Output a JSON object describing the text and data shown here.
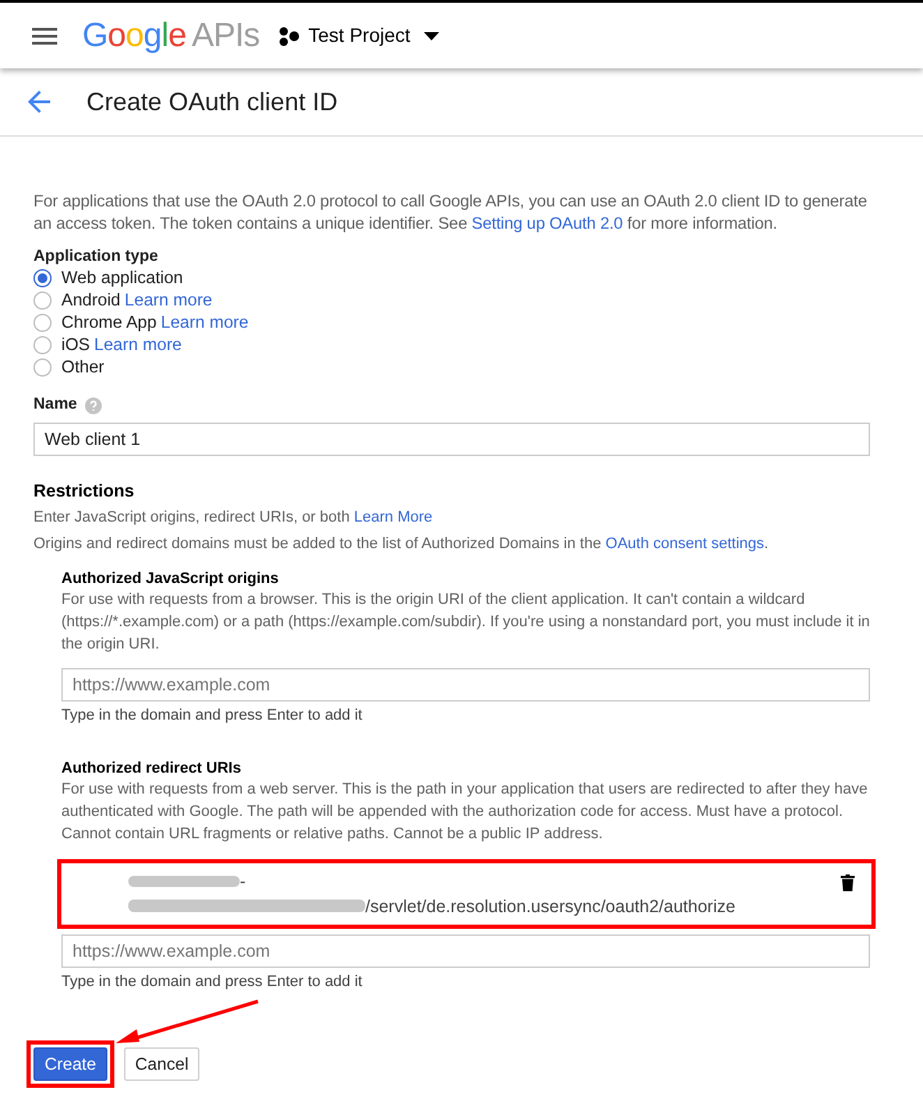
{
  "header": {
    "logo_brand": "Google",
    "logo_product": "APIs",
    "project": "Test Project"
  },
  "title_bar": {
    "title": "Create OAuth client ID"
  },
  "intro": {
    "text": "For applications that use the OAuth 2.0 protocol to call Google APIs, you can use an OAuth 2.0 client ID to generate an access token. The token contains a unique identifier. See ",
    "link": "Setting up OAuth 2.0",
    "after": " for more information."
  },
  "application_type": {
    "label": "Application type",
    "options": [
      {
        "label": "Web application",
        "selected": true
      },
      {
        "label": "Android",
        "link": "Learn more",
        "selected": false
      },
      {
        "label": "Chrome App",
        "link": "Learn more",
        "selected": false
      },
      {
        "label": "iOS",
        "link": "Learn more",
        "selected": false
      },
      {
        "label": "Other",
        "selected": false
      }
    ]
  },
  "name_field": {
    "label": "Name",
    "value": "Web client 1"
  },
  "restrictions": {
    "title": "Restrictions",
    "line_1": "Enter JavaScript origins, redirect URIs, or both ",
    "line_1_link": "Learn More",
    "line_2": "Origins and redirect domains must be added to the list of Authorized Domains in the ",
    "line_2_link": "OAuth consent settings",
    "line_2_end": "."
  },
  "sections": [
    {
      "title": "Authorized JavaScript origins",
      "description": "For use with requests from a browser. This is the origin URI of the client application. It can't contain a wildcard (https://*.example.com) or a path (https://example.com/subdir). If you're using a nonstandard port, you must include it in the origin URI.",
      "placeholder": "https://www.example.com",
      "hint": "Type in the domain and press Enter to add it"
    },
    {
      "title": "Authorized redirect URIs",
      "description": "For use with requests from a web server. This is the path in your application that users are redirected to after they have authenticated with Google. The path will be appended with the authorization code for access. Must have a protocol. Cannot contain URL fragments or relative paths. Cannot be a public IP address.",
      "entries": [
        {
          "line_1": "-",
          "line_2": "/servlet/de.resolution.usersync/oauth2/authorize",
          "highlighted": true
        }
      ],
      "placeholder": "https://www.example.com",
      "hint": "Type in the domain and press Enter to add it"
    }
  ],
  "buttons": [
    {
      "label": "Create",
      "kind": "primary",
      "highlighted": true
    },
    {
      "label": "Cancel",
      "kind": "secondary",
      "highlighted": false
    }
  ]
}
